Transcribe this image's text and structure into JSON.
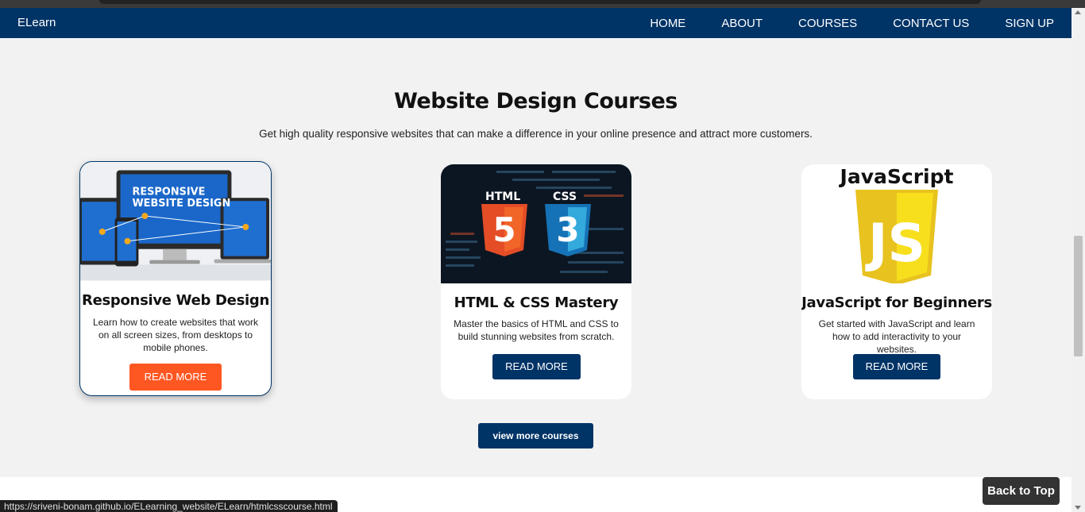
{
  "brand": "ELearn",
  "nav": [
    "HOME",
    "ABOUT",
    "COURSES",
    "CONTACT US",
    "SIGN UP"
  ],
  "section": {
    "title": "Website Design Courses",
    "subtitle": "Get high quality responsive websites that can make a difference in your online presence and attract more customers."
  },
  "cards": [
    {
      "image_text_line1": "RESPONSIVE",
      "image_text_line2": "WEBSITE DESIGN",
      "title": "Responsive Web Design",
      "text": "Learn how to create websites that work on all screen sizes, from desktops to mobile phones.",
      "button": "READ MORE"
    },
    {
      "image_text_html": "HTML",
      "image_text_css": "CSS",
      "image_num_5": "5",
      "image_num_3": "3",
      "title": "HTML & CSS Mastery",
      "text": "Master the basics of HTML and CSS to build stunning websites from scratch.",
      "button": "READ MORE"
    },
    {
      "image_text": "JavaScript",
      "image_logo": "JS",
      "title": "JavaScript for Beginners",
      "text": "Get started with JavaScript and learn how to add interactivity to your websites.",
      "button": "READ MORE"
    }
  ],
  "view_more": "view more courses",
  "back_to_top": "Back to Top",
  "status_url": "https://sriveni-bonam.github.io/ELearning_website/ELearn/htmlcsscourse.html",
  "colors": {
    "navy": "#003366",
    "orange": "#ff5722",
    "page_bg": "#f2f2f2"
  }
}
